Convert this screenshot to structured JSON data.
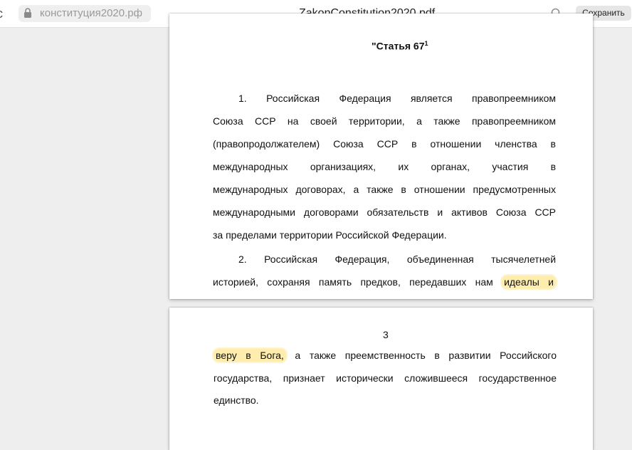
{
  "toolbar": {
    "back_glyph": "с",
    "url": "конституция2020.рф",
    "doc_title": "ZakonConstitution2020.pdf",
    "save_label": "Сохранить",
    "lock_icon": "lock-icon",
    "search_icon": "search-icon"
  },
  "page1": {
    "article_title": "\"Статья 67",
    "article_superscript": "1",
    "lines": [
      [
        "1. Российская",
        "Федерация",
        "является",
        "правопреемником"
      ],
      "Союза ССР на своей территории, а также правопреемником",
      "(правопродолжателем) Союза ССР в отношении членства в",
      [
        "международных",
        "организациях,",
        "их",
        "органах,",
        "участия",
        "в"
      ],
      "международных договорах, а также в отношении предусмотренных",
      "международными договорами обязательств и активов Союза ССР",
      "за пределами территории Российской Федерации.",
      [
        "2. Российская",
        "Федерация,",
        "объединенная",
        "тысячелетней"
      ],
      "историей, сохраняя память предков, передавших нам"
    ],
    "highlight_text": "идеалы и"
  },
  "page2": {
    "page_number": "3",
    "highlight_text": "веру в Бога,",
    "line1_rest": " а также преемственность в развитии Российского",
    "line2": "государства, признает исторически сложившееся государственное",
    "line3": "единство."
  },
  "colors": {
    "highlight": "#ffde69",
    "background": "#eeeeee",
    "page": "#ffffff"
  }
}
